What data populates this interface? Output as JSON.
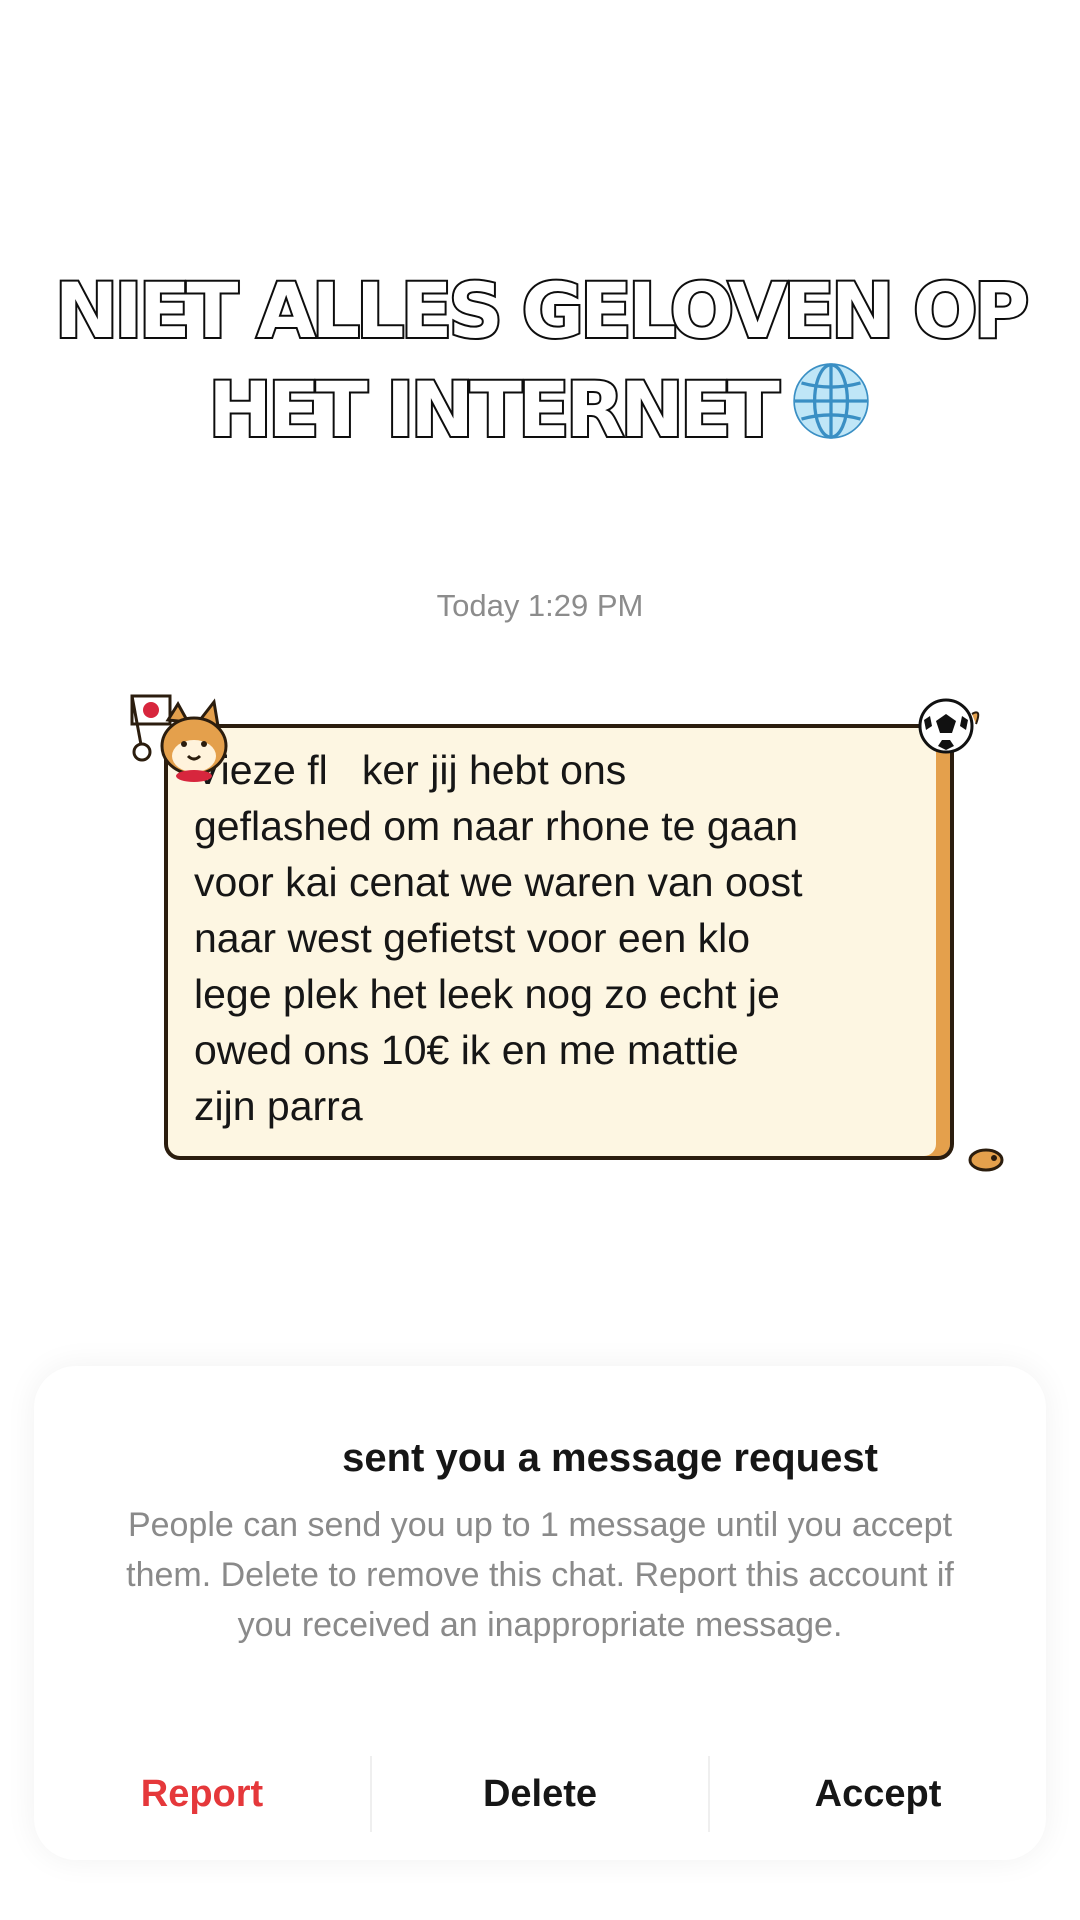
{
  "overlay": {
    "line1": "NIET ALLES GELOVEN OP",
    "line2": "HET INTERNET",
    "emoji": "globe-icon"
  },
  "chat": {
    "timestamp": "Today 1:29 PM",
    "message": "Vieze fl   ker jij hebt ons\ngeflashed om naar rhone te gaan\nvoor kai cenat we waren van oost\nnaar west gefietst voor een klo\nlege plek het leek nog zo echt je\nowed ons 10€ ik en me mattie\nzijn parra",
    "bubble_colors": {
      "fill": "#fdf6e2",
      "border": "#2b1d0e",
      "accent": "#e4a04c"
    }
  },
  "request_card": {
    "title": "sent you a message request",
    "description": "People can send you up to 1 message until you accept them. Delete to remove this chat. Report this account if you received an inappropriate message.",
    "actions": {
      "report": "Report",
      "delete": "Delete",
      "accept": "Accept"
    },
    "report_color": "#e5383b"
  }
}
